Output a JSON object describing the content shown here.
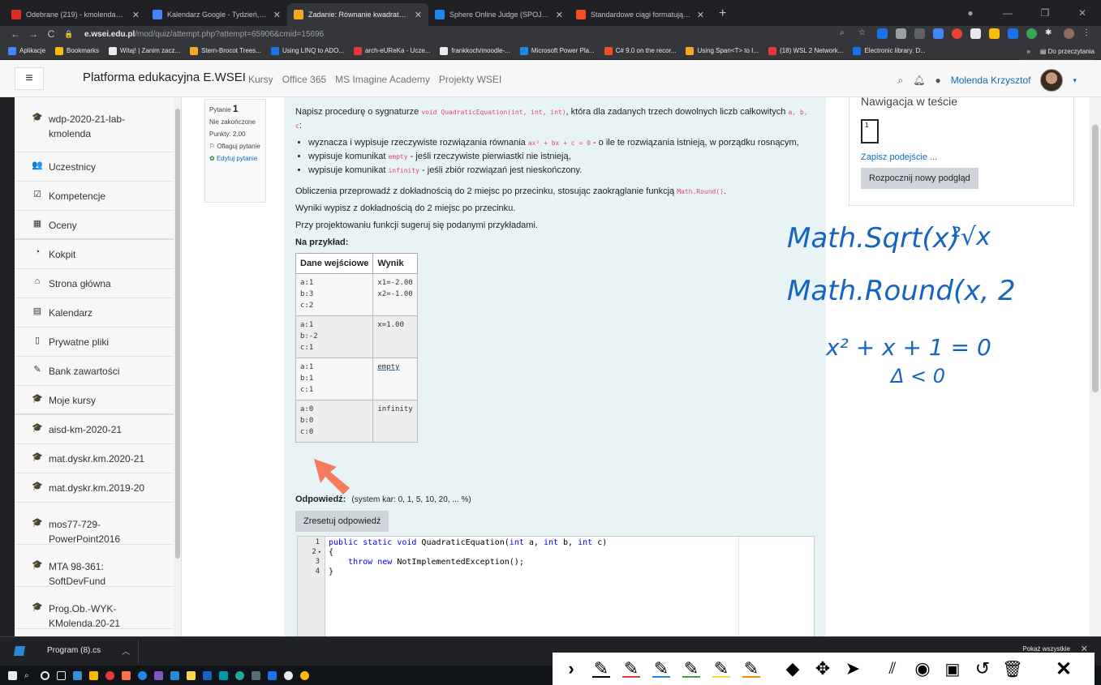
{
  "browser": {
    "tabs": [
      {
        "title": "Odebrane (219) - kmolenda@gm",
        "color": "#d93025",
        "active": false
      },
      {
        "title": "Kalendarz Google - Tydzień, w k",
        "color": "#4285f4",
        "active": false
      },
      {
        "title": "Zadanie: Równanie kwadratowe",
        "color": "#f5a623",
        "active": true
      },
      {
        "title": "Sphere Online Judge (SPOJ) - Stu",
        "color": "#1e88e5",
        "active": false
      },
      {
        "title": "Standardowe ciągi formatujące li",
        "color": "#f25022",
        "active": false
      }
    ],
    "url_host": "e.wsei.edu.pl",
    "url_path": "/mod/quiz/attempt.php?attempt=65906&cmid=15696",
    "bookmarks": [
      "Aplikacje",
      "Bookmarks",
      "Witaj! | Zanim zacz...",
      "Stern-Brocot Trees...",
      "Using LINQ to ADO...",
      "arch-eUReKa - Ucze...",
      "frankkoch/moodle-...",
      "Microsoft Power Pla...",
      "C# 9.0 on the recor...",
      "Using Span<T> to I...",
      "(18) WSL 2 Network...",
      "Electronic library. D..."
    ],
    "bookmark_more": "»",
    "reading_list": "Do przeczytania"
  },
  "navbar": {
    "brand": "Platforma edukacyjna E.WSEI",
    "links": [
      "Kursy",
      "Office 365",
      "MS Imagine Academy",
      "Projekty WSEI"
    ],
    "user": "Molenda Krzysztof"
  },
  "sidebar": {
    "items": [
      {
        "label": "wdp-2020-21-lab-kmolenda",
        "icon": "graduation-cap-icon",
        "glyph": "🎓"
      },
      {
        "label": "Uczestnicy",
        "icon": "users-icon",
        "glyph": "👥"
      },
      {
        "label": "Kompetencje",
        "icon": "check-square-icon",
        "glyph": "☑"
      },
      {
        "label": "Oceny",
        "icon": "table-icon",
        "glyph": "▦"
      },
      {
        "label": "Kokpit",
        "icon": "dashboard-icon",
        "glyph": "◔"
      },
      {
        "label": "Strona główna",
        "icon": "home-icon",
        "glyph": "⌂"
      },
      {
        "label": "Kalendarz",
        "icon": "calendar-icon",
        "glyph": "▤"
      },
      {
        "label": "Prywatne pliki",
        "icon": "file-icon",
        "glyph": "▯"
      },
      {
        "label": "Bank zawartości",
        "icon": "brush-icon",
        "glyph": "✎"
      },
      {
        "label": "Moje kursy",
        "icon": "graduation-cap-icon",
        "glyph": "🎓"
      },
      {
        "label": "aisd-km-2020-21",
        "icon": "graduation-cap-icon",
        "glyph": "🎓"
      },
      {
        "label": "mat.dyskr.km.2020-21",
        "icon": "graduation-cap-icon",
        "glyph": "🎓"
      },
      {
        "label": "mat.dyskr.km.2019-20",
        "icon": "graduation-cap-icon",
        "glyph": "🎓"
      },
      {
        "label": "mos77-729-PowerPoint2016",
        "icon": "graduation-cap-icon",
        "glyph": "🎓"
      },
      {
        "label": "MTA 98-361: SoftDevFund",
        "icon": "graduation-cap-icon",
        "glyph": "🎓"
      },
      {
        "label": "Prog.Ob.-WYK-KMolenda.20-21",
        "icon": "graduation-cap-icon",
        "glyph": "🎓"
      }
    ]
  },
  "question_info": {
    "label": "Pytanie",
    "number": "1",
    "state": "Nie zakończone",
    "points": "Punkty: 2,00",
    "flag": "Oflaguj pytanie",
    "edit": "Edytuj pytanie"
  },
  "question": {
    "intro_a": "Napisz procedurę o sygnaturze ",
    "signature": "void QuadraticEquation(int, int, int)",
    "intro_b": ", która dla zadanych trzech dowolnych liczb całkowitych ",
    "vars": "a, b, c",
    "intro_c": ":",
    "bullet1_a": "wyznacza i wypisuje rzeczywiste rozwiązania równania ",
    "bullet1_code": "ax² + bx + c = 0",
    "bullet1_b": " - o ile te rozwiązania istnieją, w porządku rosnącym,",
    "bullet2_a": "wypisuje komunikat ",
    "bullet2_code": "empty",
    "bullet2_b": " - jeśli rzeczywiste pierwiastki nie istnieją,",
    "bullet3_a": "wypisuje komunikat ",
    "bullet3_code": "infinity",
    "bullet3_b": " - jeśli zbiór rozwiązań jest nieskończony.",
    "p2_a": "Obliczenia przeprowadź z dokładnością do 2 miejsc po przecinku, stosując zaokrąglanie funkcją ",
    "p2_code": "Math.Round()",
    "p2_b": ".",
    "p3": "Wyniki wypisz z dokładnością do 2 miejsc po przecinku.",
    "p4": "Przy projektowaniu funkcji sugeruj się podanymi przykładami.",
    "example_heading": "Na przykład:",
    "table_headers": [
      "Dane wejściowe",
      "Wynik"
    ],
    "rows": [
      {
        "input": "a:1\nb:3\nc:2",
        "output": "x1=-2.00\nx2=-1.00"
      },
      {
        "input": "a:1\nb:-2\nc:1",
        "output": "x=1.00"
      },
      {
        "input": "a:1\nb:1\nc:1",
        "output": "empty"
      },
      {
        "input": "a:0\nb:0\nc:0",
        "output": "infinity"
      }
    ],
    "answer_label": "Odpowiedź:",
    "answer_hint": "(system kar: 0, 1, 5, 10, 20, ... %)",
    "reset_button": "Zresetuj odpowiedź",
    "code_lines": [
      {
        "num": "1",
        "fold": "",
        "text": "public static void QuadraticEquation(int a, int b, int c)"
      },
      {
        "num": "2",
        "fold": "▾",
        "text": "{"
      },
      {
        "num": "3",
        "fold": "",
        "text": "    throw new NotImplementedException();"
      },
      {
        "num": "4",
        "fold": "",
        "text": "}"
      }
    ]
  },
  "quiz_nav": {
    "title": "Nawigacja w teście",
    "button_number": "1",
    "finish_link": "Zapisz podejście ...",
    "preview_button": "Rozpocznij nowy podgląd"
  },
  "handwriting": {
    "line1": "Math.Sqrt(x)",
    "root": "²√x",
    "line2": "Math.Round(x, 2)",
    "line3": "x² + x + 1 = 0",
    "line4": "Δ < 0",
    "ink_color": "#1565c0"
  },
  "downloads": {
    "file": "Program (8).cs",
    "show_all": "Pokaż wszystkie"
  },
  "drawing_toolbar": {
    "pen_colors": [
      "#000000",
      "#e53935",
      "#1e88e5",
      "#43a047",
      "#fdd835",
      "#fb8c00"
    ]
  }
}
